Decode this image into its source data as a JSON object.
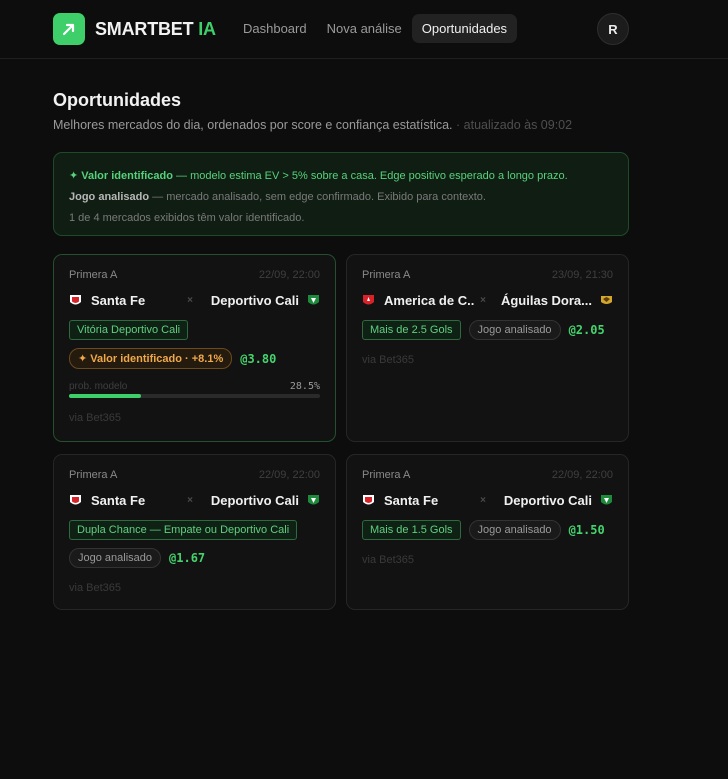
{
  "app": {
    "brand_main": "SMARTBET",
    "brand_accent": "IA",
    "nav": [
      "Dashboard",
      "Nova análise",
      "Oportunidades"
    ],
    "active_nav": "Oportunidades",
    "avatar_initial": "R",
    "accent_color": "#3ecf6b"
  },
  "page": {
    "title": "Oportunidades",
    "subtitle": "Melhores mercados do dia, ordenados por score e confiança estatística.",
    "updated": "· atualizado às 09:02"
  },
  "info": {
    "value_label": "✦ Valor identificado",
    "value_text": " — modelo estima EV > 5% sobre a casa. Edge positivo esperado a longo prazo.",
    "analysed_label": "Jogo analisado",
    "analysed_text": " — mercado analisado, sem edge confirmado. Exibido para contexto.",
    "summary": "1 de 4 mercados exibidos têm valor identificado."
  },
  "cards": [
    {
      "league": "Primera A",
      "date": "22/09, 22:00",
      "home": "Santa Fe",
      "away": "Deportivo Cali",
      "vs": "×",
      "market": "Vitória Deportivo Cali",
      "value_badge": "✦ Valor identificado · +8.1%",
      "odd": "@3.80",
      "prob_label": "prob. modelo",
      "prob_pct": "28.5%",
      "prob_value": 0.285,
      "source": "via Bet365"
    },
    {
      "league": "Primera A",
      "date": "23/09, 21:30",
      "home": "America de C...",
      "away": "Águilas Dora...",
      "vs": "×",
      "market": "Mais de 2.5 Gols",
      "status": "Jogo analisado",
      "odd": "@2.05",
      "source": "via Bet365"
    },
    {
      "league": "Primera A",
      "date": "22/09, 22:00",
      "home": "Santa Fe",
      "away": "Deportivo Cali",
      "vs": "×",
      "market": "Dupla Chance — Empate ou Deportivo Cali",
      "status": "Jogo analisado",
      "odd": "@1.67",
      "source": "via Bet365"
    },
    {
      "league": "Primera A",
      "date": "22/09, 22:00",
      "home": "Santa Fe",
      "away": "Deportivo Cali",
      "vs": "×",
      "market": "Mais de 1.5 Gols",
      "status": "Jogo analisado",
      "odd": "@1.50",
      "source": "via Bet365"
    }
  ]
}
